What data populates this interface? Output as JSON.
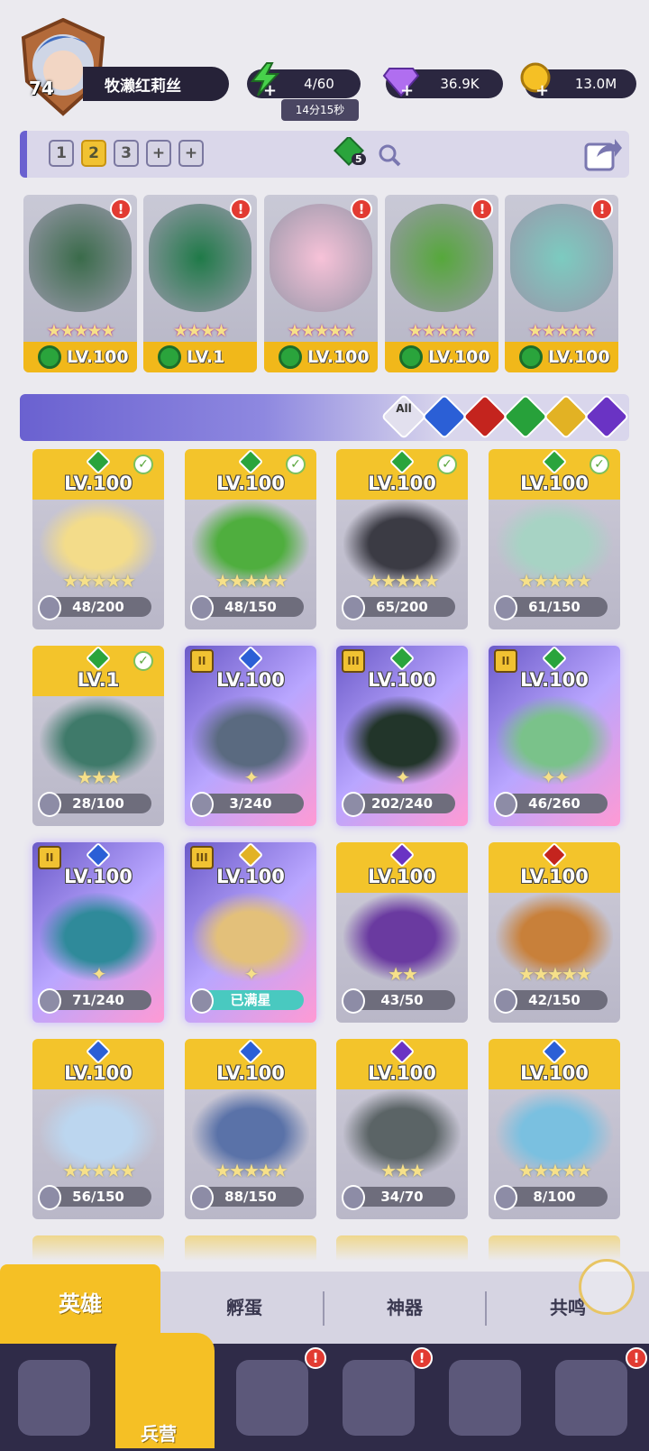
{
  "player": {
    "level": "74",
    "name": "牧濑红莉丝"
  },
  "resources": {
    "energy": "4/60",
    "energy_timer": "14分15秒",
    "gems": "36.9K",
    "coins": "13.0M"
  },
  "team_tabs": [
    "1",
    "2",
    "3",
    "+",
    "+"
  ],
  "team_badge": "5",
  "team_slots": [
    {
      "level": "LV.100",
      "stars": "★★★★★"
    },
    {
      "level": "LV.1",
      "stars": "★★★★"
    },
    {
      "level": "LV.100",
      "stars": "★★★★★"
    },
    {
      "level": "LV.100",
      "stars": "★★★★★"
    },
    {
      "level": "LV.100",
      "stars": "★★★★★"
    }
  ],
  "filter_all": "All",
  "heroes": [
    {
      "level": "LV.100",
      "progress": "48/200",
      "stars": "★★★★★"
    },
    {
      "level": "LV.100",
      "progress": "48/150",
      "stars": "★★★★★"
    },
    {
      "level": "LV.100",
      "progress": "65/200",
      "stars": "★★★★★"
    },
    {
      "level": "LV.100",
      "progress": "61/150",
      "stars": "★★★★★"
    },
    {
      "level": "LV.1",
      "progress": "28/100",
      "stars": "★★★"
    },
    {
      "level": "LV.100",
      "progress": "3/240",
      "stars": "✦"
    },
    {
      "level": "LV.100",
      "progress": "202/240",
      "stars": "✦"
    },
    {
      "level": "LV.100",
      "progress": "46/260",
      "stars": "✦✦"
    },
    {
      "level": "LV.100",
      "progress": "71/240",
      "stars": "✦"
    },
    {
      "level": "LV.100",
      "progress": "已满星",
      "stars": "✦"
    },
    {
      "level": "LV.100",
      "progress": "43/50",
      "stars": "★★"
    },
    {
      "level": "LV.100",
      "progress": "42/150",
      "stars": "★★★★★"
    },
    {
      "level": "LV.100",
      "progress": "56/150",
      "stars": "★★★★★"
    },
    {
      "level": "LV.100",
      "progress": "88/150",
      "stars": "★★★★★"
    },
    {
      "level": "LV.100",
      "progress": "34/70",
      "stars": "★★★"
    },
    {
      "level": "LV.100",
      "progress": "8/100",
      "stars": "★★★★★"
    }
  ],
  "bottom_tabs": [
    "英雄",
    "孵蛋",
    "神器",
    "共鸣"
  ],
  "nav_active_label": "兵营",
  "colors": {
    "gold": "#f5c025",
    "purple": "#6a61d0",
    "nav": "#2f2b48"
  }
}
